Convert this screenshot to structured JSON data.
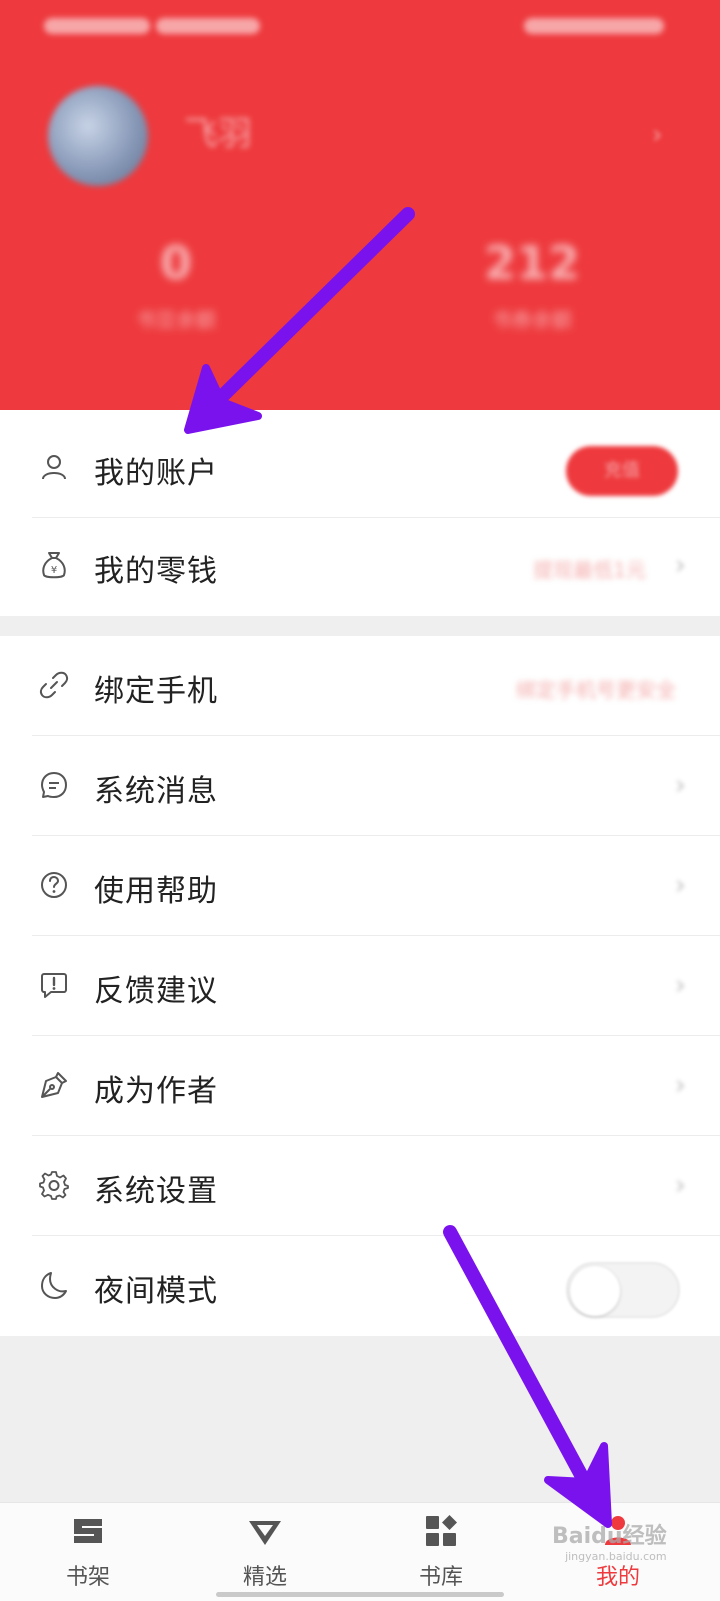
{
  "header": {
    "username": "飞羽",
    "stats": [
      {
        "value": "0",
        "label": "书豆余额"
      },
      {
        "value": "212",
        "label": "书券余额"
      }
    ],
    "account_button": "充值"
  },
  "menu_group1": [
    {
      "id": "account",
      "label": "我的账户",
      "icon": "user-icon"
    },
    {
      "id": "change",
      "label": "我的零钱",
      "icon": "money-bag-icon",
      "right_text": "提现最低1元"
    }
  ],
  "menu_group2": [
    {
      "id": "bind-phone",
      "label": "绑定手机",
      "icon": "link-icon",
      "right_text": "绑定手机号更安全"
    },
    {
      "id": "messages",
      "label": "系统消息",
      "icon": "message-icon"
    },
    {
      "id": "help",
      "label": "使用帮助",
      "icon": "help-icon"
    },
    {
      "id": "feedback",
      "label": "反馈建议",
      "icon": "feedback-icon"
    },
    {
      "id": "author",
      "label": "成为作者",
      "icon": "pen-icon"
    },
    {
      "id": "settings",
      "label": "系统设置",
      "icon": "gear-icon"
    },
    {
      "id": "night-mode",
      "label": "夜间模式",
      "icon": "moon-icon",
      "toggle": false
    }
  ],
  "tabbar": [
    {
      "label": "书架",
      "icon": "bookshelf-icon",
      "active": false
    },
    {
      "label": "精选",
      "icon": "diamond-icon",
      "active": false
    },
    {
      "label": "书库",
      "icon": "grid-icon",
      "active": false
    },
    {
      "label": "我的",
      "icon": "profile-icon",
      "active": true
    }
  ],
  "watermark": {
    "brand": "Baidu经验",
    "url": "jingyan.baidu.com"
  },
  "colors": {
    "brand_red": "#ee3a3e",
    "annotation_purple": "#7a12ee"
  }
}
